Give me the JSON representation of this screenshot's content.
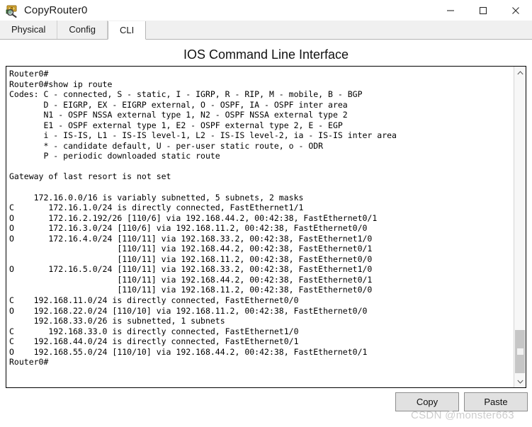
{
  "window": {
    "title": "CopyRouter0",
    "icon": "packet-tracer-router-icon",
    "controls": {
      "minimize": "—",
      "maximize": "□",
      "close": "✕"
    }
  },
  "tabs": [
    {
      "label": "Physical",
      "active": false
    },
    {
      "label": "Config",
      "active": false
    },
    {
      "label": "CLI",
      "active": true
    }
  ],
  "panel": {
    "heading": "IOS Command Line Interface"
  },
  "terminal": {
    "lines": [
      "Router0#",
      "Router0#show ip route",
      "Codes: C - connected, S - static, I - IGRP, R - RIP, M - mobile, B - BGP",
      "       D - EIGRP, EX - EIGRP external, O - OSPF, IA - OSPF inter area",
      "       N1 - OSPF NSSA external type 1, N2 - OSPF NSSA external type 2",
      "       E1 - OSPF external type 1, E2 - OSPF external type 2, E - EGP",
      "       i - IS-IS, L1 - IS-IS level-1, L2 - IS-IS level-2, ia - IS-IS inter area",
      "       * - candidate default, U - per-user static route, o - ODR",
      "       P - periodic downloaded static route",
      "",
      "Gateway of last resort is not set",
      "",
      "     172.16.0.0/16 is variably subnetted, 5 subnets, 2 masks",
      "C       172.16.1.0/24 is directly connected, FastEthernet1/1",
      "O       172.16.2.192/26 [110/6] via 192.168.44.2, 00:42:38, FastEthernet0/1",
      "O       172.16.3.0/24 [110/6] via 192.168.11.2, 00:42:38, FastEthernet0/0",
      "O       172.16.4.0/24 [110/11] via 192.168.33.2, 00:42:38, FastEthernet1/0",
      "                      [110/11] via 192.168.44.2, 00:42:38, FastEthernet0/1",
      "                      [110/11] via 192.168.11.2, 00:42:38, FastEthernet0/0",
      "O       172.16.5.0/24 [110/11] via 192.168.33.2, 00:42:38, FastEthernet1/0",
      "                      [110/11] via 192.168.44.2, 00:42:38, FastEthernet0/1",
      "                      [110/11] via 192.168.11.2, 00:42:38, FastEthernet0/0",
      "C    192.168.11.0/24 is directly connected, FastEthernet0/0",
      "O    192.168.22.0/24 [110/10] via 192.168.11.2, 00:42:38, FastEthernet0/0",
      "     192.168.33.0/26 is subnetted, 1 subnets",
      "C       192.168.33.0 is directly connected, FastEthernet1/0",
      "C    192.168.44.0/24 is directly connected, FastEthernet0/1",
      "O    192.168.55.0/24 [110/10] via 192.168.44.2, 00:42:38, FastEthernet0/1",
      "Router0#"
    ]
  },
  "scrollbar": {
    "up_arrow": "⌃",
    "down_arrow": "⌄"
  },
  "actions": {
    "copy_label": "Copy",
    "paste_label": "Paste"
  },
  "watermark": {
    "text": "CSDN @monster663"
  },
  "colors": {
    "tab_bar_bg": "#f0f0f0",
    "active_tab_bg": "#ffffff",
    "terminal_bg": "#ffffff",
    "terminal_fg": "#000000",
    "button_bg": "#e1e1e1",
    "scrollbar_thumb": "#c6c6c6",
    "watermark": "#cdcdcd"
  }
}
